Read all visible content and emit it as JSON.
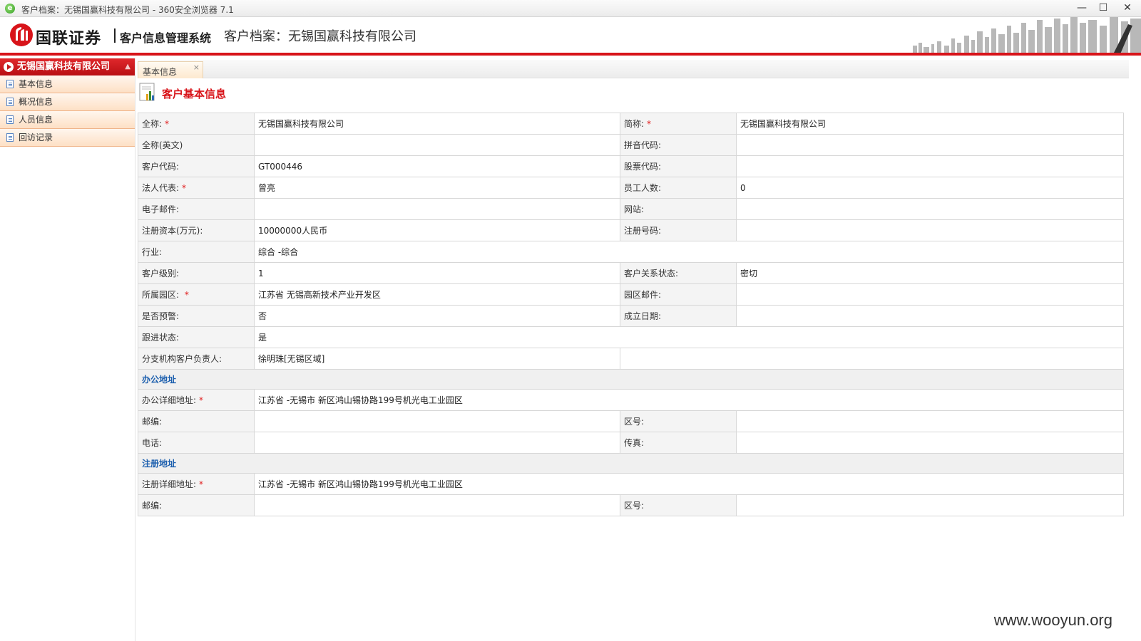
{
  "browser": {
    "title": "客户档案：无锡国赢科技有限公司 - 360安全浏览器 7.1",
    "icon": "360-browser-icon",
    "minimize": "—",
    "maximize": "☐",
    "close": "✕"
  },
  "header": {
    "brand": "国联证券",
    "system_name": "客户信息管理系统",
    "archive_title": "客户档案：无锡国赢科技有限公司",
    "accent_color": "#d8141a"
  },
  "sidebar": {
    "header": "无锡国赢科技有限公司",
    "items": [
      {
        "label": "基本信息"
      },
      {
        "label": "概况信息"
      },
      {
        "label": "人员信息"
      },
      {
        "label": "回访记录"
      }
    ]
  },
  "tabs": [
    {
      "label": "基本信息",
      "close": "×"
    }
  ],
  "section": {
    "title": "客户基本信息"
  },
  "form": {
    "full_name_label": "全称:",
    "full_name": "无锡国赢科技有限公司",
    "short_name_label": "简称:",
    "short_name": "无锡国赢科技有限公司",
    "full_name_en_label": "全称(英文)",
    "full_name_en": "",
    "pinyin_label": "拼音代码:",
    "pinyin": "",
    "client_code_label": "客户代码:",
    "client_code": "GT000446",
    "stock_code_label": "股票代码:",
    "stock_code": "",
    "legal_rep_label": "法人代表:",
    "legal_rep": "曾亮",
    "employees_label": "员工人数:",
    "employees": "0",
    "email_label": "电子邮件:",
    "email": "",
    "website_label": "网站:",
    "website": "",
    "capital_label": "注册资本(万元):",
    "capital": "10000000人民币",
    "reg_no_label": "注册号码:",
    "reg_no": "",
    "industry_label": "行业:",
    "industry": "综合 -综合",
    "level_label": "客户级别:",
    "level": "1",
    "relation_label": "客户关系状态:",
    "relation": "密切",
    "park_label": "所属园区:",
    "park": "江苏省 无锡高新技术产业开发区",
    "park_email_label": "园区邮件:",
    "park_email": "",
    "warning_label": "是否预警:",
    "warning": "否",
    "founded_label": "成立日期:",
    "founded": "",
    "follow_label": "跟进状态:",
    "follow": "是",
    "manager_label": "分支机构客户负责人:",
    "manager": "徐明珠[无锡区域]",
    "office_group": "办公地址",
    "office_addr_label": "办公详细地址:",
    "office_addr": "江苏省 -无锡市 新区鸿山锡协路199号机光电工业园区",
    "office_zip_label": "邮编:",
    "office_zip": "",
    "office_area_label": "区号:",
    "office_area": "",
    "phone_label": "电话:",
    "phone": "",
    "fax_label": "传真:",
    "fax": "",
    "reg_group": "注册地址",
    "reg_addr_label": "注册详细地址:",
    "reg_addr": "江苏省 -无锡市 新区鸿山锡协路199号机光电工业园区",
    "reg_zip_label": "邮编:",
    "reg_zip": "",
    "reg_area_label": "区号:",
    "reg_area": "",
    "required_mark": "*"
  },
  "watermark": "www.wooyun.org"
}
